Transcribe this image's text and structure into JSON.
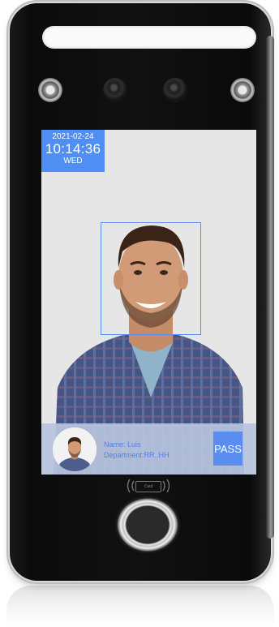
{
  "clock": {
    "date": "2021-02-24",
    "time": "10:14:36",
    "day": "WED"
  },
  "recognition": {
    "name_label": "Name:",
    "name_value": "Luis",
    "department_label": "Department:",
    "department_value": "RR..HH",
    "status_label": "PASS"
  },
  "card_reader": {
    "chip_label": "Card"
  },
  "colors": {
    "accent": "#4f8ef3",
    "info_bar": "#b7c4de",
    "face_box": "#5b8cf0"
  },
  "icons": [
    "face-detection-box",
    "card-reader-icon",
    "fingerprint-sensor-icon",
    "camera-icon",
    "ir-led-icon"
  ]
}
